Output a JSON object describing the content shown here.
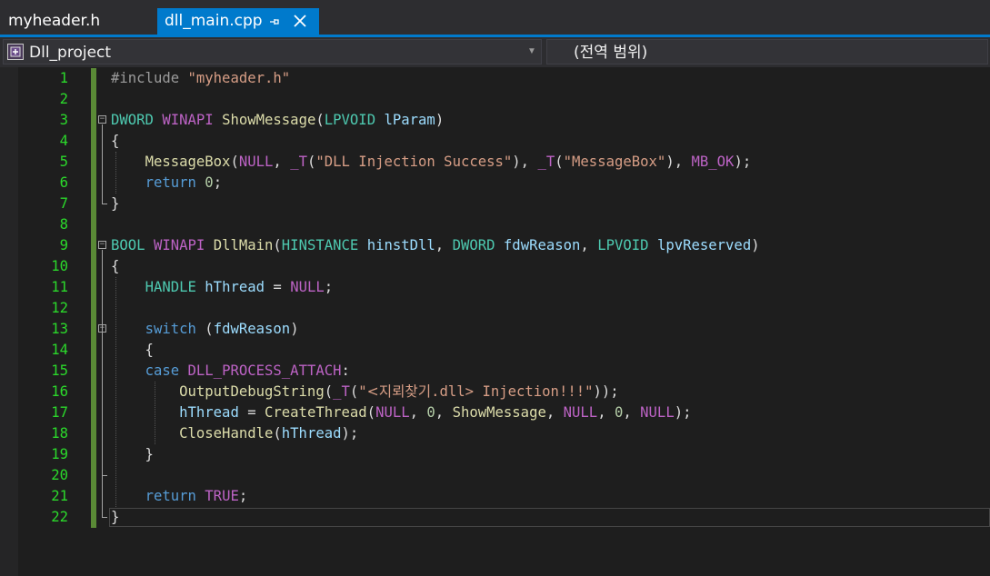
{
  "tabs": [
    {
      "label": "myheader.h",
      "active": false
    },
    {
      "label": "dll_main.cpp",
      "active": true
    }
  ],
  "active_tab_icons": {
    "pin": "pin-icon",
    "close": "close-icon"
  },
  "navbar": {
    "project": "Dll_project",
    "scope": "(전역 범위)"
  },
  "colors": {
    "accent": "#007acc",
    "line_numbers": "#2bd82b",
    "change_bar": "#5a8a36",
    "background": "#1e1e1e"
  },
  "code": {
    "line_numbers": [
      "1",
      "2",
      "3",
      "4",
      "5",
      "6",
      "7",
      "8",
      "9",
      "10",
      "11",
      "12",
      "13",
      "14",
      "15",
      "16",
      "17",
      "18",
      "19",
      "20",
      "21",
      "22"
    ],
    "lines": [
      [
        [
          "pp",
          "#include "
        ],
        [
          "str",
          "\"myheader.h\""
        ]
      ],
      [],
      [
        [
          "ty",
          "DWORD"
        ],
        [
          "pl",
          " "
        ],
        [
          "mac",
          "WINAPI"
        ],
        [
          "pl",
          " "
        ],
        [
          "fn",
          "ShowMessage"
        ],
        [
          "pl",
          "("
        ],
        [
          "ty",
          "LPVOID"
        ],
        [
          "pl",
          " "
        ],
        [
          "par",
          "lParam"
        ],
        [
          "pl",
          ")"
        ]
      ],
      [
        [
          "pl",
          "{"
        ]
      ],
      [
        [
          "pl",
          "    "
        ],
        [
          "fn",
          "MessageBox"
        ],
        [
          "pl",
          "("
        ],
        [
          "mac",
          "NULL"
        ],
        [
          "pl",
          ", "
        ],
        [
          "mac",
          "_T"
        ],
        [
          "pl",
          "("
        ],
        [
          "str",
          "\"DLL Injection Success\""
        ],
        [
          "pl",
          "), "
        ],
        [
          "mac",
          "_T"
        ],
        [
          "pl",
          "("
        ],
        [
          "str",
          "\"MessageBox\""
        ],
        [
          "pl",
          "), "
        ],
        [
          "mac",
          "MB_OK"
        ],
        [
          "pl",
          ");"
        ]
      ],
      [
        [
          "pl",
          "    "
        ],
        [
          "kw",
          "return"
        ],
        [
          "pl",
          " "
        ],
        [
          "num",
          "0"
        ],
        [
          "pl",
          ";"
        ]
      ],
      [
        [
          "pl",
          "}"
        ]
      ],
      [],
      [
        [
          "ty",
          "BOOL"
        ],
        [
          "pl",
          " "
        ],
        [
          "mac",
          "WINAPI"
        ],
        [
          "pl",
          " "
        ],
        [
          "fn",
          "DllMain"
        ],
        [
          "pl",
          "("
        ],
        [
          "ty",
          "HINSTANCE"
        ],
        [
          "pl",
          " "
        ],
        [
          "par",
          "hinstDll"
        ],
        [
          "pl",
          ", "
        ],
        [
          "ty",
          "DWORD"
        ],
        [
          "pl",
          " "
        ],
        [
          "par",
          "fdwReason"
        ],
        [
          "pl",
          ", "
        ],
        [
          "ty",
          "LPVOID"
        ],
        [
          "pl",
          " "
        ],
        [
          "par",
          "lpvReserved"
        ],
        [
          "pl",
          ")"
        ]
      ],
      [
        [
          "pl",
          "{"
        ]
      ],
      [
        [
          "pl",
          "    "
        ],
        [
          "ty",
          "HANDLE"
        ],
        [
          "pl",
          " "
        ],
        [
          "lv",
          "hThread"
        ],
        [
          "pl",
          " = "
        ],
        [
          "mac",
          "NULL"
        ],
        [
          "pl",
          ";"
        ]
      ],
      [],
      [
        [
          "pl",
          "    "
        ],
        [
          "kw",
          "switch"
        ],
        [
          "pl",
          " ("
        ],
        [
          "par",
          "fdwReason"
        ],
        [
          "pl",
          ")"
        ]
      ],
      [
        [
          "pl",
          "    {"
        ]
      ],
      [
        [
          "pl",
          "    "
        ],
        [
          "kw",
          "case"
        ],
        [
          "pl",
          " "
        ],
        [
          "mac",
          "DLL_PROCESS_ATTACH"
        ],
        [
          "pl",
          ":"
        ]
      ],
      [
        [
          "pl",
          "        "
        ],
        [
          "fn",
          "OutputDebugString"
        ],
        [
          "pl",
          "("
        ],
        [
          "mac",
          "_T"
        ],
        [
          "pl",
          "("
        ],
        [
          "str",
          "\""
        ],
        [
          "strkr",
          "<지뢰찾기"
        ],
        [
          "str",
          ".dll> Injection!!!\""
        ],
        [
          "pl",
          "));"
        ]
      ],
      [
        [
          "pl",
          "        "
        ],
        [
          "lv",
          "hThread"
        ],
        [
          "pl",
          " = "
        ],
        [
          "fn",
          "CreateThread"
        ],
        [
          "pl",
          "("
        ],
        [
          "mac",
          "NULL"
        ],
        [
          "pl",
          ", "
        ],
        [
          "num",
          "0"
        ],
        [
          "pl",
          ", "
        ],
        [
          "fn",
          "ShowMessage"
        ],
        [
          "pl",
          ", "
        ],
        [
          "mac",
          "NULL"
        ],
        [
          "pl",
          ", "
        ],
        [
          "num",
          "0"
        ],
        [
          "pl",
          ", "
        ],
        [
          "mac",
          "NULL"
        ],
        [
          "pl",
          ");"
        ]
      ],
      [
        [
          "pl",
          "        "
        ],
        [
          "fn",
          "CloseHandle"
        ],
        [
          "pl",
          "("
        ],
        [
          "lv",
          "hThread"
        ],
        [
          "pl",
          ");"
        ]
      ],
      [
        [
          "pl",
          "    }"
        ]
      ],
      [],
      [
        [
          "pl",
          "    "
        ],
        [
          "kw",
          "return"
        ],
        [
          "pl",
          " "
        ],
        [
          "mac",
          "TRUE"
        ],
        [
          "pl",
          ";"
        ]
      ],
      [
        [
          "pl",
          "}"
        ]
      ]
    ]
  }
}
